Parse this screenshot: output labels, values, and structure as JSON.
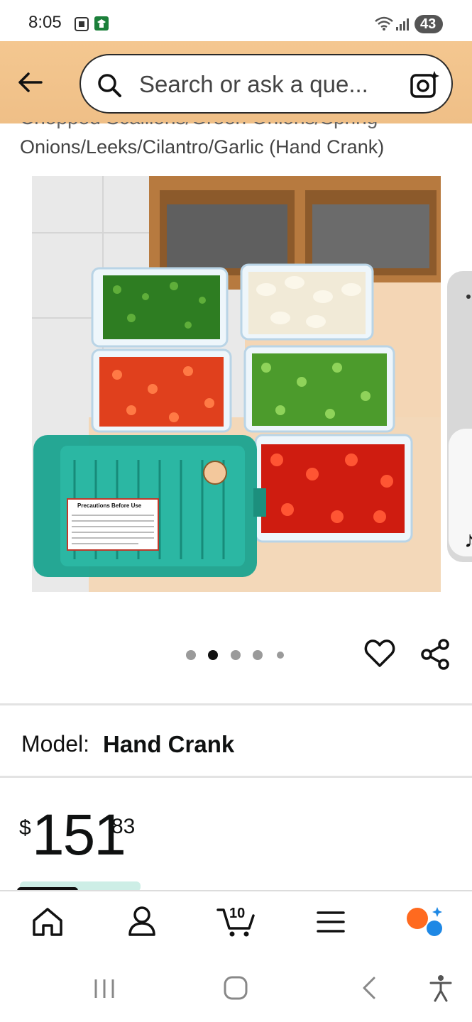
{
  "status_bar": {
    "time": "8:05",
    "battery": "43"
  },
  "search": {
    "placeholder": "Search or ask a que..."
  },
  "product": {
    "title_partial_hidden": "Chopped Scallions/Green Onions/Spring",
    "title_line": "Onions/Leeks/Cilantro/Garlic (Hand Crank)",
    "image_count": 5,
    "active_image": 2,
    "model_label": "Model:",
    "model_value": "Hand Crank",
    "price_symbol": "$",
    "price_whole": "151",
    "price_fraction": "83"
  },
  "image_text": {
    "warning_label": "Precautions Before Use"
  },
  "nav": {
    "cart_count": "10"
  },
  "colors": {
    "header": "#f2c389",
    "accent_orange": "#ff6a1f",
    "accent_blue": "#1e88e5"
  }
}
